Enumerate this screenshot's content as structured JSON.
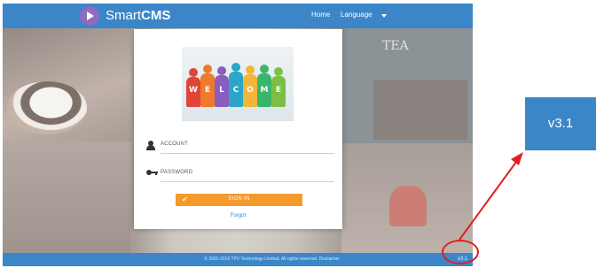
{
  "header": {
    "brand_light": "Smart",
    "brand_bold": "CMS",
    "nav_home": "Home",
    "nav_language": "Language"
  },
  "login": {
    "welcome_letters": [
      "W",
      "E",
      "L",
      "C",
      "O",
      "M",
      "E"
    ],
    "account_label": "ACCOUNT",
    "password_label": "PASSWORD",
    "signin_label": "SIGN IN",
    "forgot_label": "Forgot"
  },
  "background": {
    "tea_sign": "TEA"
  },
  "footer": {
    "copyright": "© 2001-2016 TPV Technology Limited. All rights reserved. Disclaimer",
    "version": "v3.1"
  },
  "callout": {
    "version": "v3.1"
  },
  "colors": {
    "brand_blue": "#3b86c8",
    "signin_orange": "#f39a2a",
    "logo_purple": "#8e6bbf",
    "annotation_red": "#e02020"
  }
}
